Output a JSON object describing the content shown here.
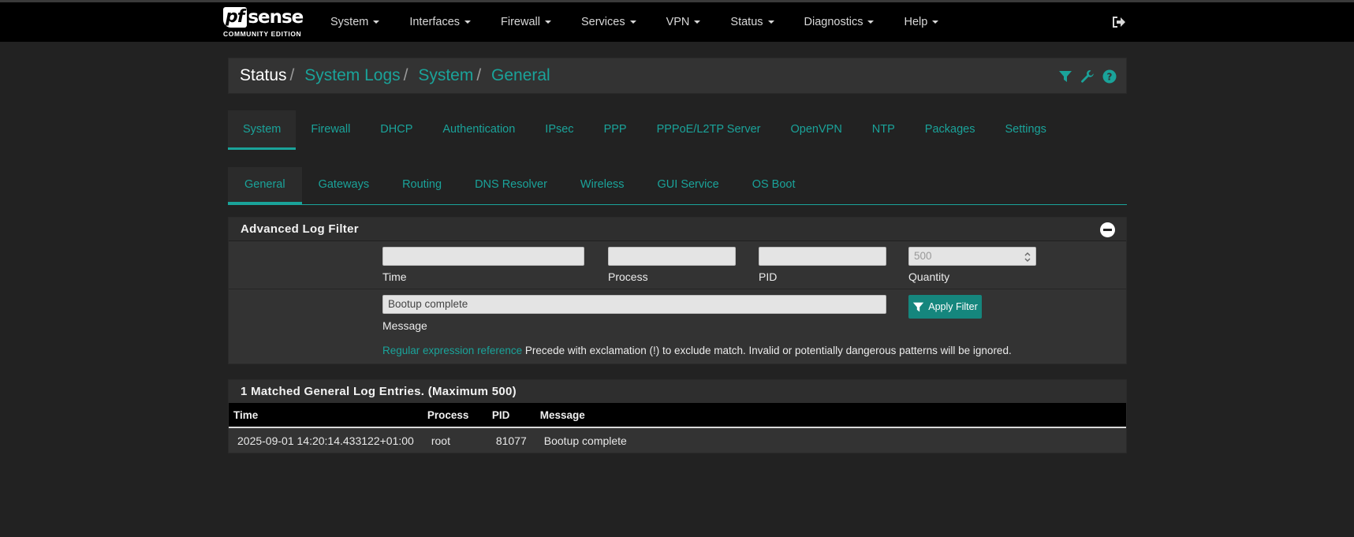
{
  "brand": {
    "logo_mark": "pf",
    "logo_word": "sense",
    "edition": "COMMUNITY EDITION"
  },
  "nav": {
    "items": [
      {
        "label": "System"
      },
      {
        "label": "Interfaces"
      },
      {
        "label": "Firewall"
      },
      {
        "label": "Services"
      },
      {
        "label": "VPN"
      },
      {
        "label": "Status"
      },
      {
        "label": "Diagnostics"
      },
      {
        "label": "Help"
      }
    ],
    "logout_icon": "sign-out-icon"
  },
  "breadcrumb": {
    "current": "Status",
    "links": [
      "System Logs",
      "System",
      "General"
    ],
    "icons": [
      "filter-icon",
      "wrench-icon",
      "question-circle-icon"
    ]
  },
  "tabs_primary": {
    "items": [
      "System",
      "Firewall",
      "DHCP",
      "Authentication",
      "IPsec",
      "PPP",
      "PPPoE/L2TP Server",
      "OpenVPN",
      "NTP",
      "Packages",
      "Settings"
    ],
    "active": "System"
  },
  "tabs_secondary": {
    "items": [
      "General",
      "Gateways",
      "Routing",
      "DNS Resolver",
      "Wireless",
      "GUI Service",
      "OS Boot"
    ],
    "active": "General"
  },
  "filter": {
    "title": "Advanced Log Filter",
    "time_label": "Time",
    "time_value": "",
    "process_label": "Process",
    "process_value": "",
    "pid_label": "PID",
    "pid_value": "",
    "quantity_label": "Quantity",
    "quantity_placeholder": "500",
    "message_label": "Message",
    "message_value": "Bootup complete",
    "apply_label": "Apply Filter",
    "regex_link": "Regular expression reference",
    "help_text": "Precede with exclamation (!) to exclude match. Invalid or potentially dangerous patterns will be ignored."
  },
  "results": {
    "title": "1 Matched General Log Entries. (Maximum 500)",
    "columns": [
      "Time",
      "Process",
      "PID",
      "Message"
    ],
    "rows": [
      {
        "time": "2025-09-01 14:20:14.433122+01:00",
        "process": "root",
        "pid": "81077",
        "message": "Bootup complete"
      }
    ]
  },
  "colors": {
    "accent": "#1aa39a",
    "button": "#15867d",
    "background": "#222222",
    "panel": "#333333",
    "navbar": "#000000"
  }
}
